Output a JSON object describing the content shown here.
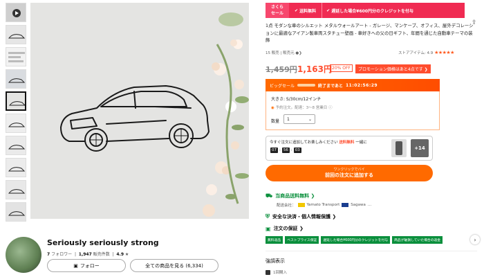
{
  "store": {
    "name": "Seriously seriously strong",
    "followers_count": "7",
    "followers_label": "フォロワー",
    "sold_count": "1,947",
    "sold_label": "販売件数",
    "rating": "4.9",
    "follow_label": "フォロー",
    "all_items_label": "全ての商品を見る (6,334)"
  },
  "banner": {
    "logo_line1": "さくら",
    "logo_line2": "セール",
    "ship_label": "送料無料",
    "credit_label": "遅延した場合¥600円分のクレジットを付与"
  },
  "product": {
    "title": "1点 モダンな車のシルエット メタルウォールアート - ガレージ、マンケーブ、オフィス、屋外デコレーションに最適なアイアン製車両スタチュー壁画 - 車好きへの父の日ギフト、年間を通じた自動車テーマの装飾",
    "sold_text": "15 販売 | 販売元",
    "store_rating_label": "ストアアイテム: 4.9",
    "stars": "★★★★★",
    "old_price": "1,459円",
    "new_price": "1,163円",
    "discount": "20% OFF",
    "promo": "プロモーション価格はあと4点です ❯"
  },
  "flash": {
    "label": "ビッグセール",
    "ends_label": "終了まであと",
    "time": "11:02:56:29"
  },
  "sku": {
    "size_label": "大きさ: S/30cm/12インチ",
    "lot_note": "予約注文。配達：3〜8 営業日",
    "qty_label": "数量",
    "qty_value": "1"
  },
  "upsell": {
    "text": "今すぐ注文に追加してお楽しみください",
    "free_text": "送料無料",
    "suffix": "一緒に",
    "timer_h": "07",
    "timer_m": "56",
    "timer_s": "03",
    "more_count": "+14"
  },
  "cart": {
    "small_label": "ワンクリックでバイ",
    "main_label": "前回の注文に追加する"
  },
  "shipping": {
    "title": "当商品送料無料 ❯",
    "carrier_prefix": "配送会社：",
    "carrier1": "Yamato Transport",
    "carrier2": "Sagawa",
    "more": "..."
  },
  "safe": {
    "label": "安全な決済・個人情報保護 ❯"
  },
  "guarantee": {
    "label": "注文の保証 ❯",
    "badges": [
      "無料返品",
      "ベストプライス保証",
      "遅延した場合¥600円分のクレジットを付与",
      "商品が破損していた場合の返金"
    ]
  },
  "highlight": {
    "title": "強調表示",
    "buy_count": "1回購入"
  },
  "icons": {
    "share": "share-icon",
    "next": "chevron-right-icon"
  }
}
